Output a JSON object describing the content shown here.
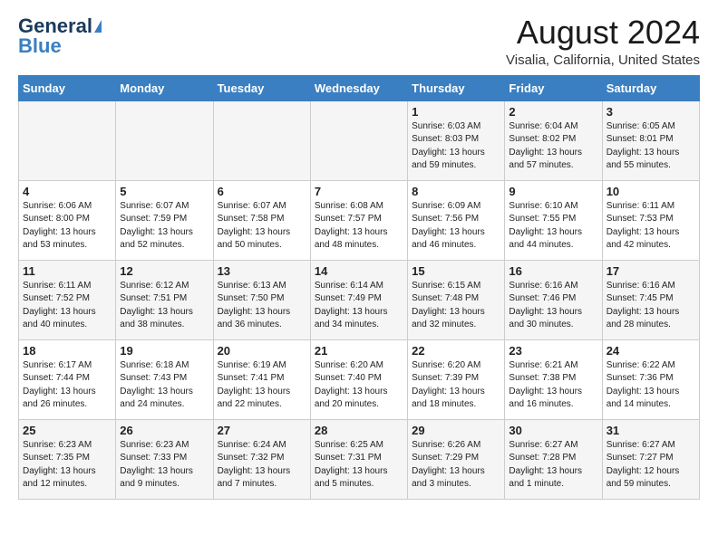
{
  "header": {
    "logo_general": "General",
    "logo_blue": "Blue",
    "main_title": "August 2024",
    "subtitle": "Visalia, California, United States"
  },
  "weekdays": [
    "Sunday",
    "Monday",
    "Tuesday",
    "Wednesday",
    "Thursday",
    "Friday",
    "Saturday"
  ],
  "weeks": [
    [
      {
        "day": "",
        "info": ""
      },
      {
        "day": "",
        "info": ""
      },
      {
        "day": "",
        "info": ""
      },
      {
        "day": "",
        "info": ""
      },
      {
        "day": "1",
        "info": "Sunrise: 6:03 AM\nSunset: 8:03 PM\nDaylight: 13 hours\nand 59 minutes."
      },
      {
        "day": "2",
        "info": "Sunrise: 6:04 AM\nSunset: 8:02 PM\nDaylight: 13 hours\nand 57 minutes."
      },
      {
        "day": "3",
        "info": "Sunrise: 6:05 AM\nSunset: 8:01 PM\nDaylight: 13 hours\nand 55 minutes."
      }
    ],
    [
      {
        "day": "4",
        "info": "Sunrise: 6:06 AM\nSunset: 8:00 PM\nDaylight: 13 hours\nand 53 minutes."
      },
      {
        "day": "5",
        "info": "Sunrise: 6:07 AM\nSunset: 7:59 PM\nDaylight: 13 hours\nand 52 minutes."
      },
      {
        "day": "6",
        "info": "Sunrise: 6:07 AM\nSunset: 7:58 PM\nDaylight: 13 hours\nand 50 minutes."
      },
      {
        "day": "7",
        "info": "Sunrise: 6:08 AM\nSunset: 7:57 PM\nDaylight: 13 hours\nand 48 minutes."
      },
      {
        "day": "8",
        "info": "Sunrise: 6:09 AM\nSunset: 7:56 PM\nDaylight: 13 hours\nand 46 minutes."
      },
      {
        "day": "9",
        "info": "Sunrise: 6:10 AM\nSunset: 7:55 PM\nDaylight: 13 hours\nand 44 minutes."
      },
      {
        "day": "10",
        "info": "Sunrise: 6:11 AM\nSunset: 7:53 PM\nDaylight: 13 hours\nand 42 minutes."
      }
    ],
    [
      {
        "day": "11",
        "info": "Sunrise: 6:11 AM\nSunset: 7:52 PM\nDaylight: 13 hours\nand 40 minutes."
      },
      {
        "day": "12",
        "info": "Sunrise: 6:12 AM\nSunset: 7:51 PM\nDaylight: 13 hours\nand 38 minutes."
      },
      {
        "day": "13",
        "info": "Sunrise: 6:13 AM\nSunset: 7:50 PM\nDaylight: 13 hours\nand 36 minutes."
      },
      {
        "day": "14",
        "info": "Sunrise: 6:14 AM\nSunset: 7:49 PM\nDaylight: 13 hours\nand 34 minutes."
      },
      {
        "day": "15",
        "info": "Sunrise: 6:15 AM\nSunset: 7:48 PM\nDaylight: 13 hours\nand 32 minutes."
      },
      {
        "day": "16",
        "info": "Sunrise: 6:16 AM\nSunset: 7:46 PM\nDaylight: 13 hours\nand 30 minutes."
      },
      {
        "day": "17",
        "info": "Sunrise: 6:16 AM\nSunset: 7:45 PM\nDaylight: 13 hours\nand 28 minutes."
      }
    ],
    [
      {
        "day": "18",
        "info": "Sunrise: 6:17 AM\nSunset: 7:44 PM\nDaylight: 13 hours\nand 26 minutes."
      },
      {
        "day": "19",
        "info": "Sunrise: 6:18 AM\nSunset: 7:43 PM\nDaylight: 13 hours\nand 24 minutes."
      },
      {
        "day": "20",
        "info": "Sunrise: 6:19 AM\nSunset: 7:41 PM\nDaylight: 13 hours\nand 22 minutes."
      },
      {
        "day": "21",
        "info": "Sunrise: 6:20 AM\nSunset: 7:40 PM\nDaylight: 13 hours\nand 20 minutes."
      },
      {
        "day": "22",
        "info": "Sunrise: 6:20 AM\nSunset: 7:39 PM\nDaylight: 13 hours\nand 18 minutes."
      },
      {
        "day": "23",
        "info": "Sunrise: 6:21 AM\nSunset: 7:38 PM\nDaylight: 13 hours\nand 16 minutes."
      },
      {
        "day": "24",
        "info": "Sunrise: 6:22 AM\nSunset: 7:36 PM\nDaylight: 13 hours\nand 14 minutes."
      }
    ],
    [
      {
        "day": "25",
        "info": "Sunrise: 6:23 AM\nSunset: 7:35 PM\nDaylight: 13 hours\nand 12 minutes."
      },
      {
        "day": "26",
        "info": "Sunrise: 6:23 AM\nSunset: 7:33 PM\nDaylight: 13 hours\nand 9 minutes."
      },
      {
        "day": "27",
        "info": "Sunrise: 6:24 AM\nSunset: 7:32 PM\nDaylight: 13 hours\nand 7 minutes."
      },
      {
        "day": "28",
        "info": "Sunrise: 6:25 AM\nSunset: 7:31 PM\nDaylight: 13 hours\nand 5 minutes."
      },
      {
        "day": "29",
        "info": "Sunrise: 6:26 AM\nSunset: 7:29 PM\nDaylight: 13 hours\nand 3 minutes."
      },
      {
        "day": "30",
        "info": "Sunrise: 6:27 AM\nSunset: 7:28 PM\nDaylight: 13 hours\nand 1 minute."
      },
      {
        "day": "31",
        "info": "Sunrise: 6:27 AM\nSunset: 7:27 PM\nDaylight: 12 hours\nand 59 minutes."
      }
    ]
  ]
}
